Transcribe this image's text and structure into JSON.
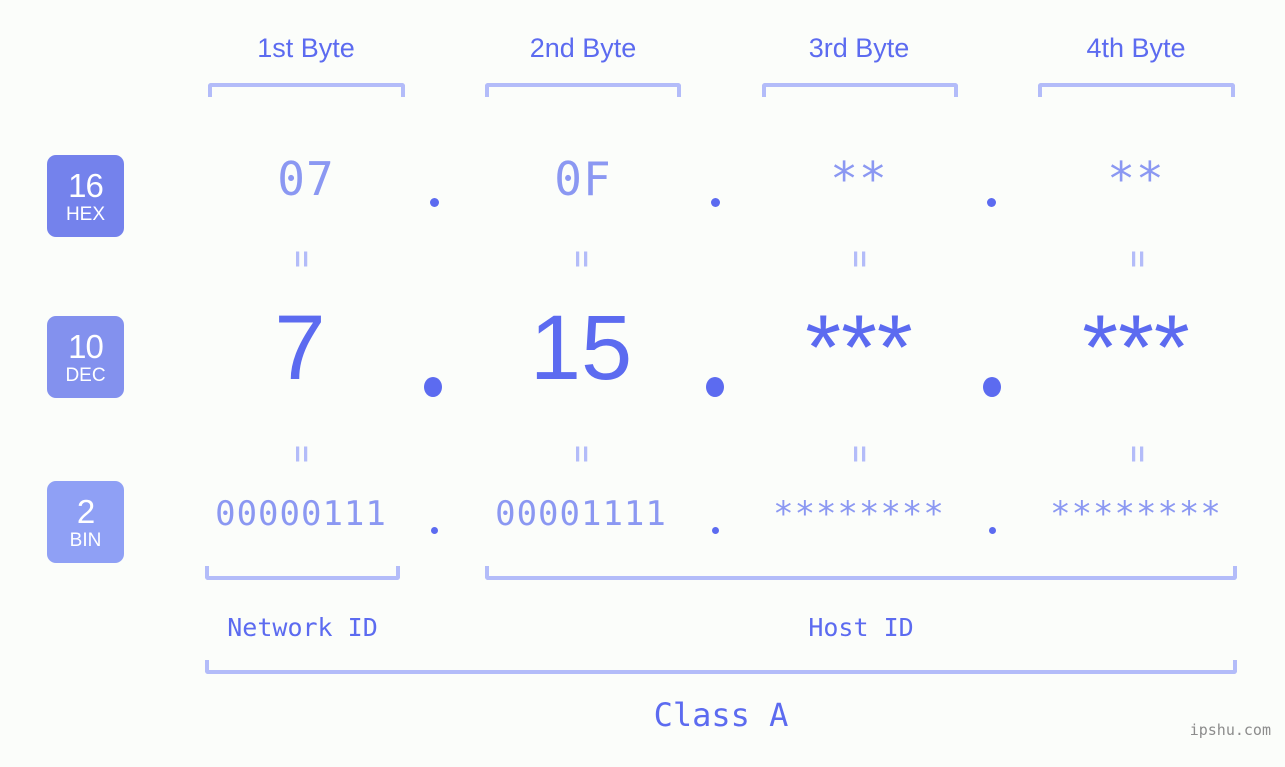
{
  "watermark": "ipshu.com",
  "colors": {
    "background": "#fbfdfa",
    "accent": "#5c6bf0",
    "accent_light": "#8b98f2",
    "bracket": "#b3bcf9",
    "badge_hex": "#7482ec",
    "badge_dec": "#8391ee",
    "badge_bin": "#8fa0f5",
    "watermark": "#8c8c8c"
  },
  "byte_headers": [
    {
      "label": "1st Byte"
    },
    {
      "label": "2nd Byte"
    },
    {
      "label": "3rd Byte"
    },
    {
      "label": "4th Byte"
    }
  ],
  "bases": [
    {
      "number": "16",
      "name": "HEX"
    },
    {
      "number": "10",
      "name": "DEC"
    },
    {
      "number": "2",
      "name": "BIN"
    }
  ],
  "rows": {
    "hex": {
      "values": [
        "07",
        "0F",
        "**",
        "**"
      ],
      "separator": "."
    },
    "dec": {
      "values": [
        "7",
        "15",
        "***",
        "***"
      ],
      "separator": "."
    },
    "bin": {
      "values": [
        "00000111",
        "00001111",
        "********",
        "********"
      ],
      "separator": "."
    }
  },
  "equals_symbol": "=",
  "segments": {
    "network_id": "Network ID",
    "host_id": "Host ID",
    "ip_class": "Class A"
  }
}
